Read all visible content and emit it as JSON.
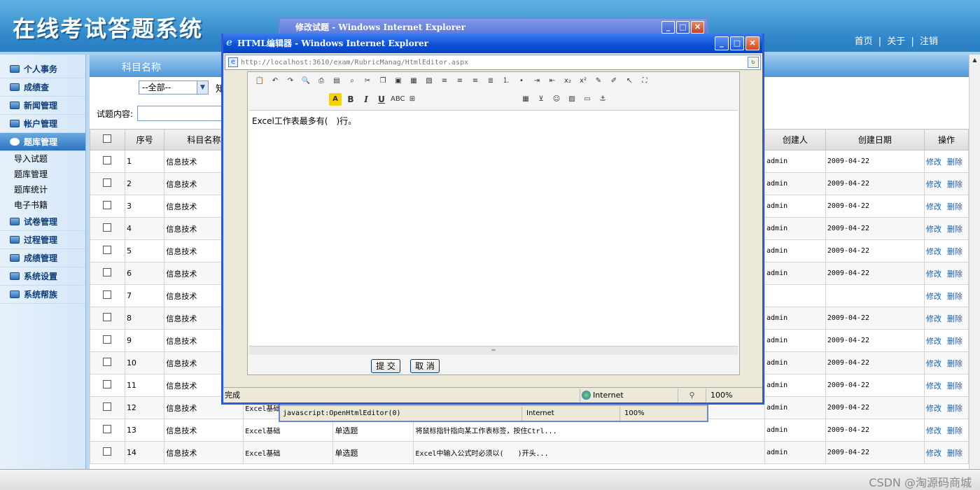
{
  "app": {
    "title": "在线考试答题系统",
    "top_links": [
      "首页",
      "关于",
      "注销"
    ],
    "link_separator": "|"
  },
  "sidebar": {
    "items": [
      {
        "label": "个人事务"
      },
      {
        "label": "成绩查"
      },
      {
        "label": "新闻管理"
      },
      {
        "label": "帐户管理"
      },
      {
        "label": "题库管理",
        "active": true
      }
    ],
    "sub_items": [
      "导入试题",
      "题库管理",
      "题库统计",
      "电子书籍"
    ],
    "items_after": [
      {
        "label": "试卷管理"
      },
      {
        "label": "过程管理"
      },
      {
        "label": "成绩管理"
      },
      {
        "label": "系统设置"
      },
      {
        "label": "系统帮族"
      }
    ]
  },
  "main": {
    "section_title": "科目名称",
    "filter_select": "--全部--",
    "filter_next_label": "知",
    "content_label": "试题内容:",
    "table": {
      "headers": [
        "序号",
        "科目名称",
        "创建人",
        "创建日期",
        "操作"
      ],
      "rows": [
        {
          "no": "1",
          "subject": "信息技术",
          "course": "",
          "type": "",
          "content": "",
          "creator": "admin",
          "date": "2009-04-22"
        },
        {
          "no": "2",
          "subject": "信息技术",
          "course": "",
          "type": "",
          "content": "",
          "creator": "admin",
          "date": "2009-04-22"
        },
        {
          "no": "3",
          "subject": "信息技术",
          "course": "",
          "type": "",
          "content": "",
          "creator": "admin",
          "date": "2009-04-22"
        },
        {
          "no": "4",
          "subject": "信息技术",
          "course": "",
          "type": "",
          "content": "",
          "creator": "admin",
          "date": "2009-04-22"
        },
        {
          "no": "5",
          "subject": "信息技术",
          "course": "",
          "type": "",
          "content": "",
          "creator": "admin",
          "date": "2009-04-22"
        },
        {
          "no": "6",
          "subject": "信息技术",
          "course": "",
          "type": "",
          "content": "",
          "creator": "admin",
          "date": "2009-04-22"
        },
        {
          "no": "7",
          "subject": "信息技术",
          "course": "",
          "type": "",
          "content": "",
          "creator": "",
          "date": ""
        },
        {
          "no": "8",
          "subject": "信息技术",
          "course": "",
          "type": "",
          "content": "",
          "creator": "admin",
          "date": "2009-04-22"
        },
        {
          "no": "9",
          "subject": "信息技术",
          "course": "",
          "type": "",
          "content": "",
          "creator": "admin",
          "date": "2009-04-22"
        },
        {
          "no": "10",
          "subject": "信息技术",
          "course": "",
          "type": "",
          "content": "",
          "creator": "admin",
          "date": "2009-04-22"
        },
        {
          "no": "11",
          "subject": "信息技术",
          "course": "",
          "type": "",
          "content": "",
          "creator": "admin",
          "date": "2009-04-22"
        },
        {
          "no": "12",
          "subject": "信息技术",
          "course": "Excel基础",
          "type": "",
          "content": "",
          "creator": "admin",
          "date": "2009-04-22"
        },
        {
          "no": "13",
          "subject": "信息技术",
          "course": "Excel基础",
          "type": "单选题",
          "content": "将鼠标指针指向某工作表标签，按住Ctrl...",
          "creator": "admin",
          "date": "2009-04-22"
        },
        {
          "no": "14",
          "subject": "信息技术",
          "course": "Excel基础",
          "type": "单选题",
          "content": "Excel中输入公式时必须以(　　)开头...",
          "creator": "admin",
          "date": "2009-04-22"
        }
      ],
      "actions": {
        "edit": "修改",
        "delete": "删除"
      }
    }
  },
  "bg_window": {
    "title": "修改试题 - Windows Internet Explorer",
    "status_js": "javascript:OpenHtmlEditor(0)",
    "status_zone": "Internet",
    "status_zoom": "100%"
  },
  "editor_window": {
    "title": "HTML编辑器 - Windows Internet Explorer",
    "address": "http://localhost:3610/exam/RubricManag/HtmlEditor.aspx",
    "content": "Excel工作表最多有(　)行。",
    "submit_label": "提 交",
    "cancel_label": "取 消",
    "status_done": "完成",
    "status_zone": "Internet",
    "status_zoom": "100%",
    "toolbar_glyphs": {
      "bold": "B",
      "italic": "I",
      "underline": "U",
      "strike": "ABC",
      "subscript": "x₂",
      "superscript": "x²",
      "font_color": "A"
    }
  },
  "watermark": "CSDN @淘源码商城",
  "colors": {
    "banner": "#2f86c9",
    "title_bar": "#0a4fd4",
    "accent": "#1b5fb0"
  }
}
